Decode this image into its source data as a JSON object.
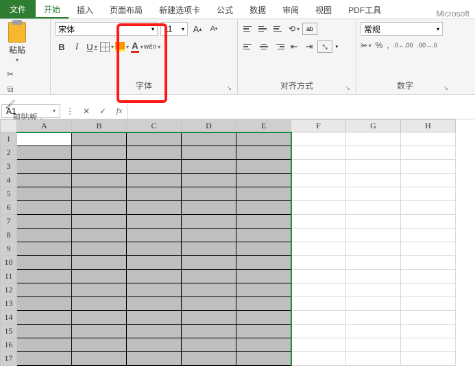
{
  "tabs": {
    "file": "文件",
    "home": "开始",
    "insert": "插入",
    "layout": "页面布局",
    "newtab": "新建选项卡",
    "formula": "公式",
    "data": "数据",
    "review": "审阅",
    "view": "视图",
    "pdf": "PDF工具"
  },
  "title_fragment": "Microsoft",
  "ribbon": {
    "clipboard": {
      "paste": "粘贴",
      "group": "剪贴板"
    },
    "font": {
      "name": "宋体",
      "size": "11",
      "bold": "B",
      "italic": "I",
      "underline": "U",
      "color_letter": "A",
      "wen": "wén",
      "group": "字体"
    },
    "align": {
      "group": "对齐方式"
    },
    "number": {
      "format": "常规",
      "percent": "%",
      "comma": ",",
      "dec_inc": ".0←.00",
      "dec_dec": ".00→.0",
      "currency": "⭃",
      "group": "数字"
    }
  },
  "namebox": "A1",
  "fx": "fx",
  "columns": [
    "A",
    "B",
    "C",
    "D",
    "E",
    "F",
    "G",
    "H"
  ],
  "rows": [
    1,
    2,
    3,
    4,
    5,
    6,
    7,
    8,
    9,
    10,
    11,
    12,
    13,
    14,
    15,
    16,
    17
  ],
  "selection": {
    "active": "A1",
    "cols": [
      "A",
      "B",
      "C",
      "D",
      "E"
    ],
    "all_rows": true
  }
}
